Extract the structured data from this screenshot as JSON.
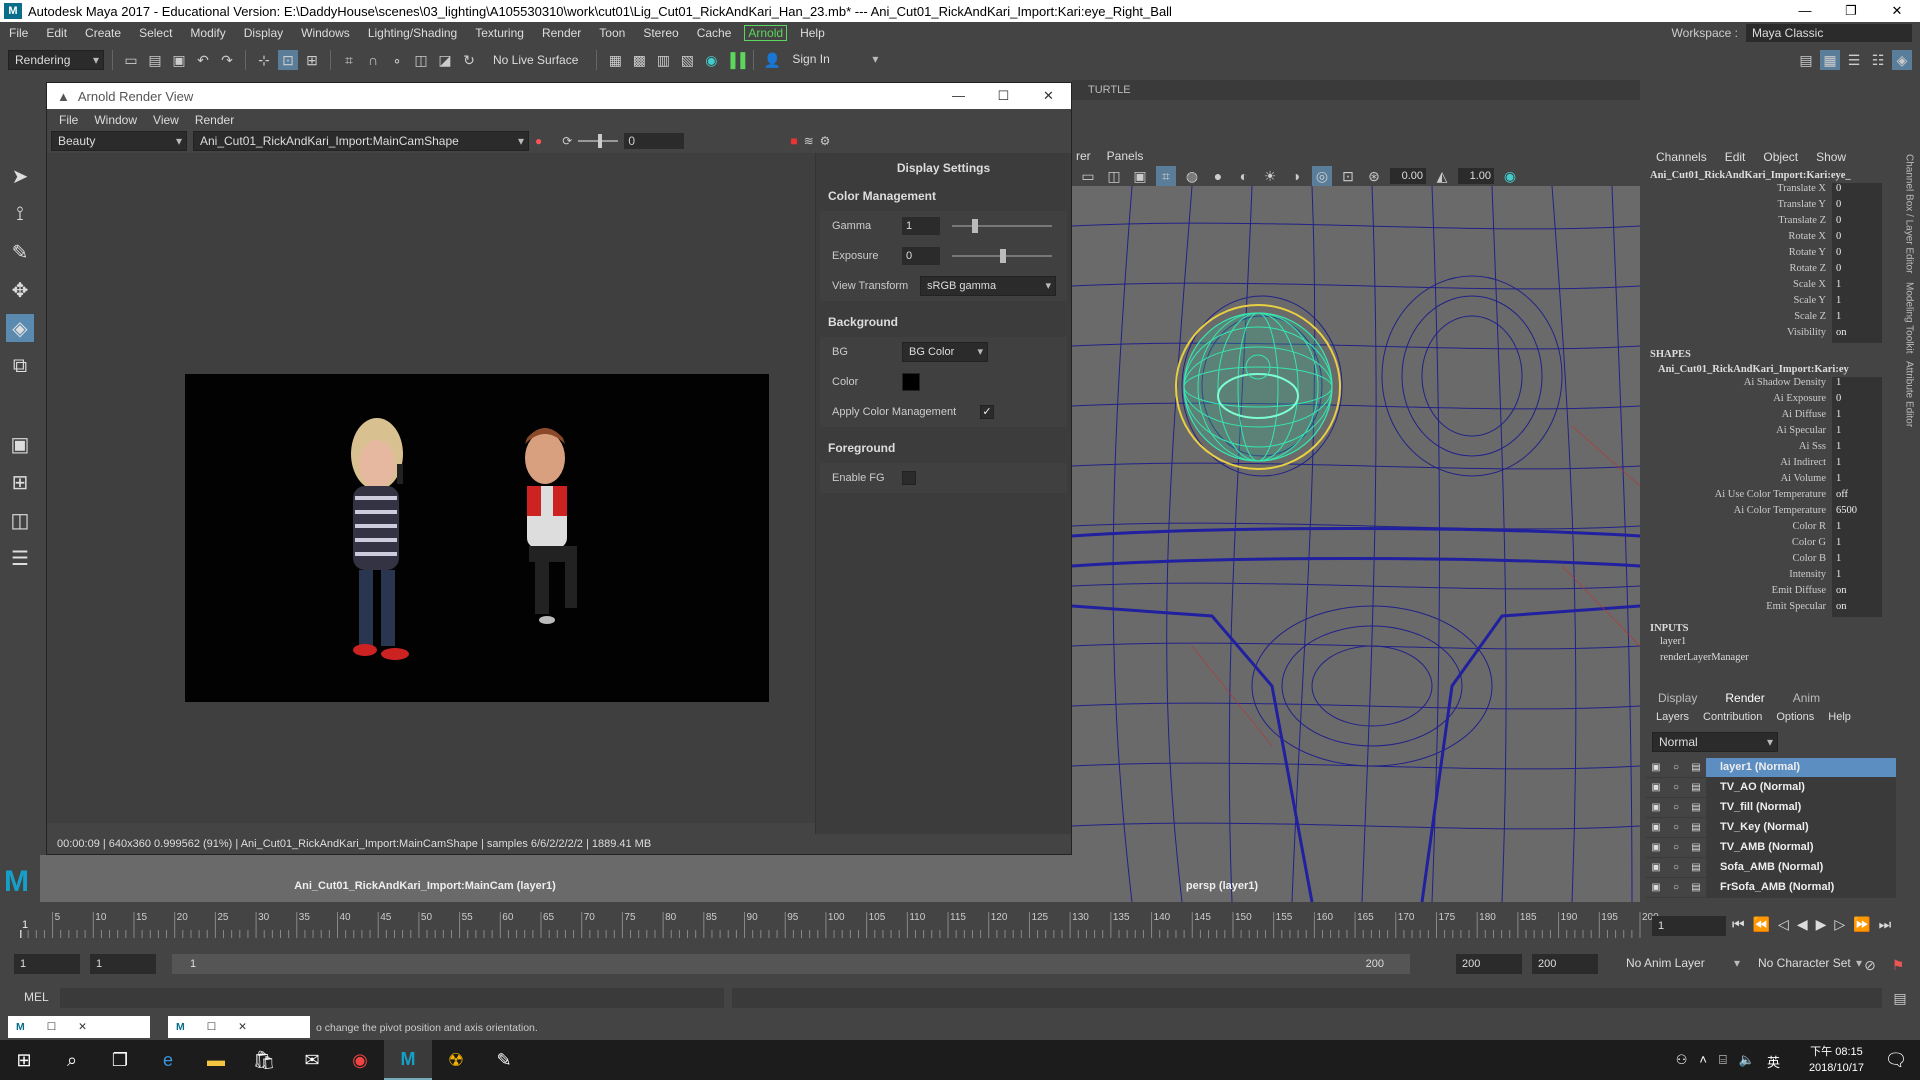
{
  "title": "Autodesk Maya 2017 - Educational Version: E:\\DaddyHouse\\scenes\\03_lighting\\A105530310\\work\\cut01\\Lig_Cut01_RickAndKari_Han_23.mb*  ---  Ani_Cut01_RickAndKari_Import:Kari:eye_Right_Ball",
  "menus": [
    "File",
    "Edit",
    "Create",
    "Select",
    "Modify",
    "Display",
    "Windows",
    "Lighting/Shading",
    "Texturing",
    "Render",
    "Toon",
    "Stereo",
    "Cache",
    "Arnold",
    "Help"
  ],
  "workspace": {
    "label": "Workspace :",
    "value": "Maya Classic"
  },
  "status": {
    "menuset": "Rendering",
    "live_surface": "No Live Surface",
    "sign_in": "Sign In"
  },
  "arv": {
    "title": "Arnold Render View",
    "menus": [
      "File",
      "Window",
      "View",
      "Render"
    ],
    "aov": "Beauty",
    "camera": "Ani_Cut01_RickAndKari_Import:MainCamShape",
    "exposure_value": "0",
    "status_text": "00:00:09 | 640x360 0.999562 (91%) | Ani_Cut01_RickAndKari_Import:MainCamShape | samples 6/6/2/2/2/2 | 1889.41 MB"
  },
  "display_settings": {
    "title": "Display Settings",
    "color_management": "Color Management",
    "gamma_label": "Gamma",
    "gamma": "1",
    "exposure_label": "Exposure",
    "exposure": "0",
    "view_transform_label": "View Transform",
    "view_transform": "sRGB gamma",
    "background": "Background",
    "bg_label": "BG",
    "bg": "BG Color",
    "color_label": "Color",
    "apply_cm": "Apply Color Management",
    "foreground": "Foreground",
    "enable_fg": "Enable FG"
  },
  "turtle_tab": "TURTLE",
  "viewport": {
    "menus": [
      "rer",
      "Panels"
    ],
    "val1": "0.00",
    "val2": "1.00",
    "label": "persp (layer1)"
  },
  "cam_label": "Ani_Cut01_RickAndKari_Import:MainCam (layer1)",
  "channel_box": {
    "tabs": [
      "Channels",
      "Edit",
      "Object",
      "Show"
    ],
    "object": "Ani_Cut01_RickAndKari_Import:Kari:eye_",
    "attrs": [
      {
        "n": "Translate X",
        "v": "0"
      },
      {
        "n": "Translate Y",
        "v": "0"
      },
      {
        "n": "Translate Z",
        "v": "0"
      },
      {
        "n": "Rotate X",
        "v": "0"
      },
      {
        "n": "Rotate Y",
        "v": "0"
      },
      {
        "n": "Rotate Z",
        "v": "0"
      },
      {
        "n": "Scale X",
        "v": "1"
      },
      {
        "n": "Scale Y",
        "v": "1"
      },
      {
        "n": "Scale Z",
        "v": "1"
      },
      {
        "n": "Visibility",
        "v": "on"
      }
    ],
    "shapes_header": "SHAPES",
    "shape_name": "Ani_Cut01_RickAndKari_Import:Kari:ey",
    "shape_attrs": [
      {
        "n": "Ai Shadow Density",
        "v": "1"
      },
      {
        "n": "Ai Exposure",
        "v": "0"
      },
      {
        "n": "Ai Diffuse",
        "v": "1"
      },
      {
        "n": "Ai Specular",
        "v": "1"
      },
      {
        "n": "Ai Sss",
        "v": "1"
      },
      {
        "n": "Ai Indirect",
        "v": "1"
      },
      {
        "n": "Ai Volume",
        "v": "1"
      },
      {
        "n": "Ai Use Color Temperature",
        "v": "off"
      },
      {
        "n": "Ai Color Temperature",
        "v": "6500"
      },
      {
        "n": "Color R",
        "v": "1"
      },
      {
        "n": "Color G",
        "v": "1"
      },
      {
        "n": "Color B",
        "v": "1"
      },
      {
        "n": "Intensity",
        "v": "1"
      },
      {
        "n": "Emit Diffuse",
        "v": "on"
      },
      {
        "n": "Emit Specular",
        "v": "on"
      }
    ],
    "inputs_header": "INPUTS",
    "inputs": [
      "layer1",
      "renderLayerManager"
    ]
  },
  "side_tabs": [
    "Channel Box / Layer Editor",
    "Modeling Toolkit",
    "Attribute Editor"
  ],
  "layer_editor": {
    "tabs": [
      "Display",
      "Render",
      "Anim"
    ],
    "sub": [
      "Layers",
      "Contribution",
      "Options",
      "Help"
    ],
    "mode": "Normal",
    "layers": [
      "layer1 (Normal)",
      "TV_AO (Normal)",
      "TV_fill (Normal)",
      "TV_Key (Normal)",
      "TV_AMB (Normal)",
      "Sofa_AMB (Normal)",
      "FrSofa_AMB (Normal)"
    ]
  },
  "timeline": {
    "ticks": [
      "5",
      "10",
      "15",
      "20",
      "25",
      "30",
      "35",
      "40",
      "45",
      "50",
      "55",
      "60",
      "65",
      "70",
      "75",
      "80",
      "85",
      "90",
      "95",
      "100",
      "105",
      "110",
      "115",
      "120",
      "125",
      "130",
      "135",
      "140",
      "145",
      "150",
      "155",
      "160",
      "165",
      "170",
      "175",
      "180",
      "185",
      "190",
      "195",
      "200"
    ],
    "first": "1",
    "current": "1"
  },
  "range": {
    "start": "1",
    "start2": "1",
    "bar_start": "1",
    "bar_end": "200",
    "end": "200",
    "end2": "200",
    "anim_layer": "No Anim Layer",
    "char_set": "No Character Set"
  },
  "mel": "MEL",
  "help_text": "o change the pivot position and axis orientation.",
  "taskbar_clock": {
    "time": "下午 08:15",
    "date": "2018/10/17"
  }
}
